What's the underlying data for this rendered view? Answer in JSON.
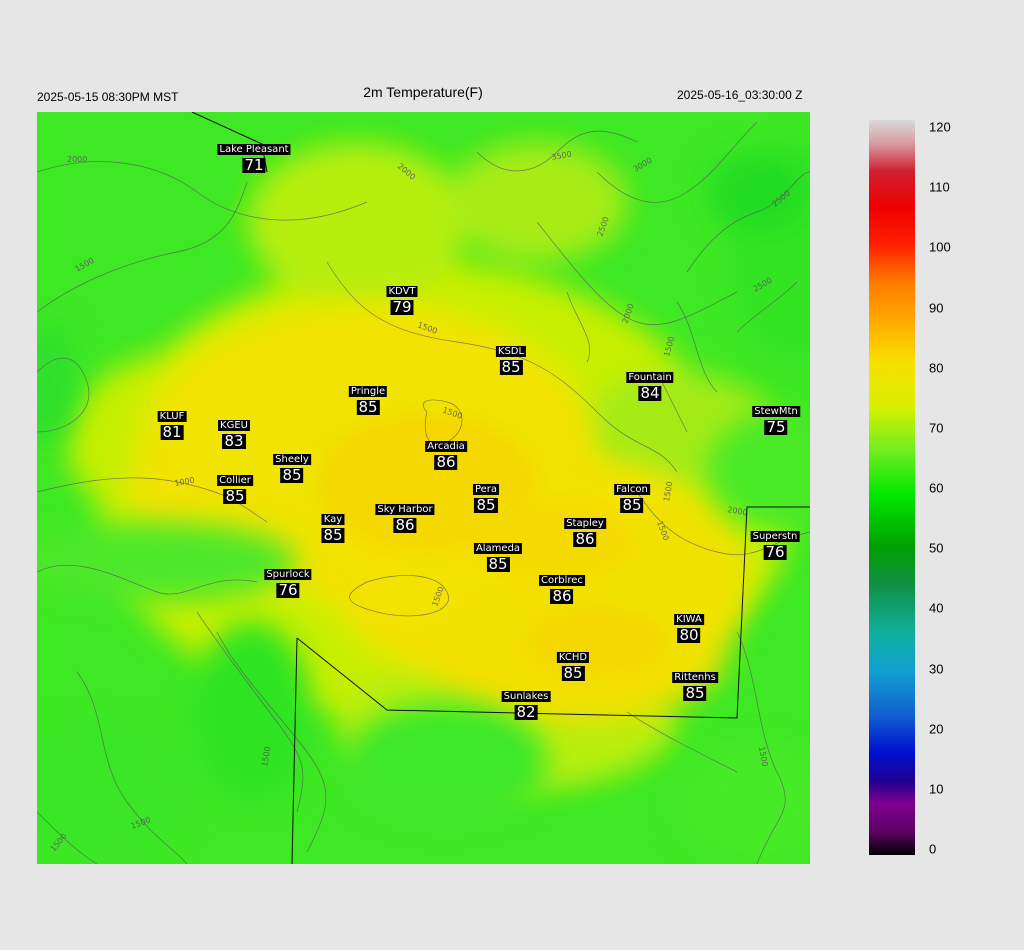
{
  "header": {
    "local_time": "2025-05-15 08:30PM MST",
    "title": "2m Temperature(F)",
    "utc_time": "2025-05-16_03:30:00 Z"
  },
  "stations": [
    {
      "name": "Lake Pleasant",
      "value": "71"
    },
    {
      "name": "KDVT",
      "value": "79"
    },
    {
      "name": "KSDL",
      "value": "85"
    },
    {
      "name": "Fountain",
      "value": "84"
    },
    {
      "name": "StewMtn",
      "value": "75"
    },
    {
      "name": "Pringle",
      "value": "85"
    },
    {
      "name": "KLUF",
      "value": "81"
    },
    {
      "name": "KGEU",
      "value": "83"
    },
    {
      "name": "Arcadia",
      "value": "86"
    },
    {
      "name": "Sheely",
      "value": "85"
    },
    {
      "name": "Collier",
      "value": "85"
    },
    {
      "name": "Pera",
      "value": "85"
    },
    {
      "name": "Falcon",
      "value": "85"
    },
    {
      "name": "Kay",
      "value": "85"
    },
    {
      "name": "Sky Harbor",
      "value": "86"
    },
    {
      "name": "Stapley",
      "value": "86"
    },
    {
      "name": "Superstn",
      "value": "76"
    },
    {
      "name": "Alameda",
      "value": "85"
    },
    {
      "name": "Spurlock",
      "value": "76"
    },
    {
      "name": "Corblrec",
      "value": "86"
    },
    {
      "name": "KIWA",
      "value": "80"
    },
    {
      "name": "KCHD",
      "value": "85"
    },
    {
      "name": "Rittenhs",
      "value": "85"
    },
    {
      "name": "Sunlakes",
      "value": "82"
    }
  ],
  "contour_labels": [
    "2000",
    "1500",
    "1500",
    "2000",
    "2500",
    "3000",
    "3500",
    "2500",
    "2000",
    "1500",
    "1500",
    "1500",
    "2500",
    "1000",
    "2000",
    "1500",
    "1500",
    "1500",
    "1500",
    "1500",
    "1500"
  ],
  "colorbar": {
    "labels": [
      "120",
      "110",
      "100",
      "90",
      "80",
      "70",
      "60",
      "50",
      "40",
      "30",
      "20",
      "10",
      "0"
    ],
    "min": 0,
    "max": 120
  },
  "colors": {
    "background": "#e6e6e6",
    "green": "#33ee22",
    "yellow_green": "#ccf000",
    "yellow": "#f6e600",
    "gold": "#f2d200"
  }
}
